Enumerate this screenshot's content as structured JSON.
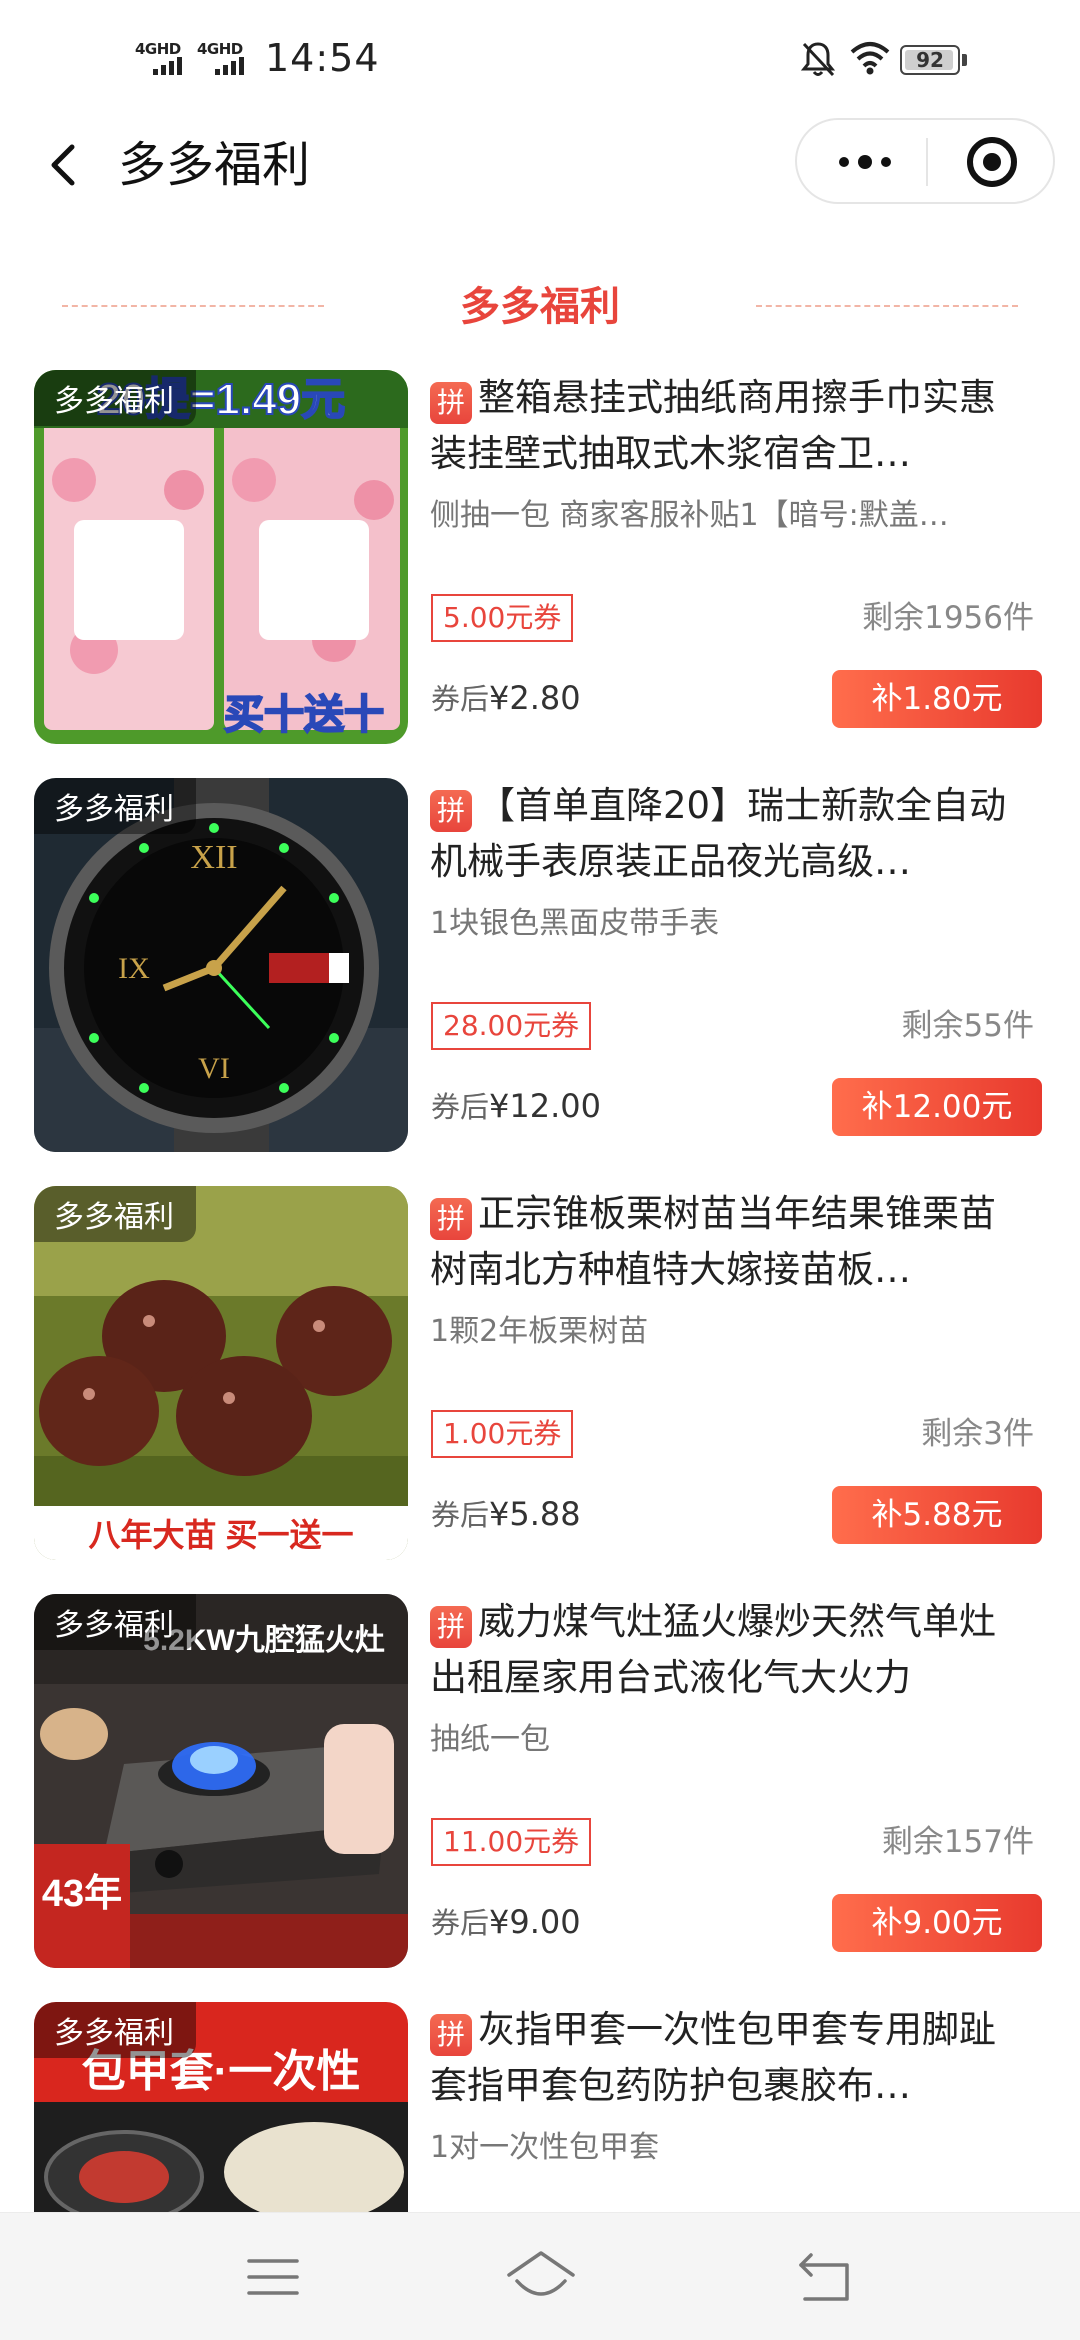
{
  "status_bar": {
    "network_1": "4GHD",
    "network_2": "4GHD",
    "time": "14:54",
    "battery": "92"
  },
  "nav": {
    "title": "多多福利"
  },
  "section": {
    "title": "多多福利"
  },
  "products": [
    {
      "watermark": "多多福利",
      "badge": "拼",
      "title": "整箱悬挂式抽纸商用擦手巾实惠装挂壁式抽取式木浆宿舍卫…",
      "subtitle": "侧抽一包 商家客服补贴1【暗号:默盖…",
      "coupon": "5.00元券",
      "remaining": "剩余1956件",
      "after_label": "券后",
      "after_price": "¥2.80",
      "subsidy": "补1.80元",
      "image_text_top": "20提=1.49元",
      "image_text_bottom": "买十送十"
    },
    {
      "watermark": "多多福利",
      "badge": "拼",
      "title": "【首单直降20】瑞士新款全自动机械手表原装正品夜光高级…",
      "subtitle": "1块银色黑面皮带手表",
      "coupon": "28.00元券",
      "remaining": "剩余55件",
      "after_label": "券后",
      "after_price": "¥12.00",
      "subsidy": "补12.00元"
    },
    {
      "watermark": "多多福利",
      "badge": "拼",
      "title": "正宗锥板栗树苗当年结果锥栗苗树南北方种植特大嫁接苗板…",
      "subtitle": "1颗2年板栗树苗",
      "coupon": "1.00元券",
      "remaining": "剩余3件",
      "after_label": "券后",
      "after_price": "¥5.88",
      "subsidy": "补5.88元",
      "image_text_bottom": "八年大苗 买一送一"
    },
    {
      "watermark": "多多福利",
      "badge": "拼",
      "title": "威力煤气灶猛火爆炒天然气单灶出租屋家用台式液化气大火力",
      "subtitle": "抽纸一包",
      "coupon": "11.00元券",
      "remaining": "剩余157件",
      "after_label": "券后",
      "after_price": "¥9.00",
      "subsidy": "补9.00元",
      "image_text_top": "5.2KW九腔猛火灶",
      "image_text_badge": "43年"
    },
    {
      "watermark": "多多福利",
      "badge": "拼",
      "title": "灰指甲套一次性包甲套专用脚趾套指甲套包药防护包裹胶布…",
      "subtitle": "1对一次性包甲套",
      "image_text_top": "包甲套·一次性"
    }
  ],
  "colors": {
    "accent": "#e8453c",
    "button": "#f05a3a"
  }
}
